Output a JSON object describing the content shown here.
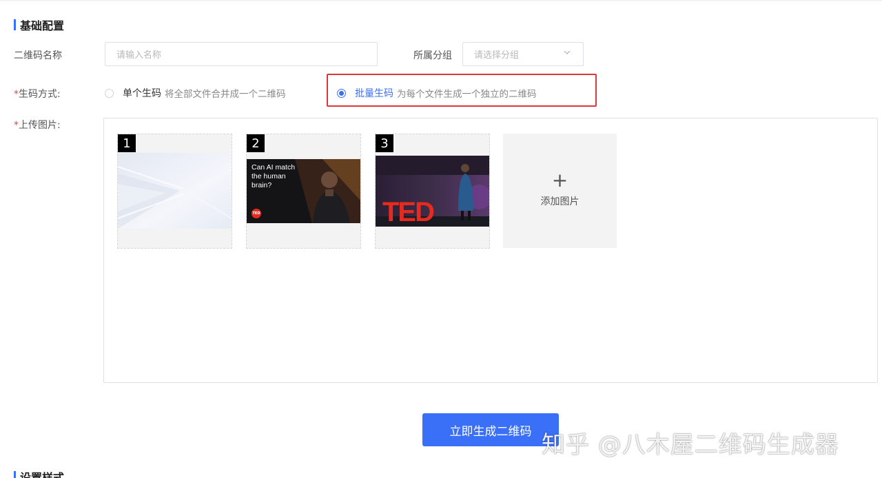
{
  "basic_config": {
    "title": "基础配置",
    "qr_name_label": "二维码名称",
    "qr_name_placeholder": "请输入名称",
    "group_label": "所属分组",
    "group_placeholder": "请选择分组",
    "gen_mode": {
      "required_mark": "*",
      "label": "生码方式:",
      "options": [
        {
          "title": "单个生码",
          "desc": "将全部文件合并成一个二维码",
          "selected": false
        },
        {
          "title": "批量生码",
          "desc": "为每个文件生成一个独立的二维码",
          "selected": true
        }
      ]
    },
    "upload": {
      "required_mark": "*",
      "label": "上传图片:",
      "images": [
        {
          "index": "1"
        },
        {
          "index": "2",
          "overlay_text": "Can AI match the human brain?",
          "badge": "TED"
        },
        {
          "index": "3",
          "sign_text": "TED"
        }
      ],
      "add_label": "添加图片"
    },
    "generate_button": "立即生成二维码"
  },
  "style_section": {
    "title": "设置样式"
  },
  "watermark": "知乎 @八木屋二维码生成器",
  "colors": {
    "accent": "#3a6ff8",
    "required": "#e64545",
    "highlight": "#d9383a",
    "ted_red": "#e62b1e"
  }
}
